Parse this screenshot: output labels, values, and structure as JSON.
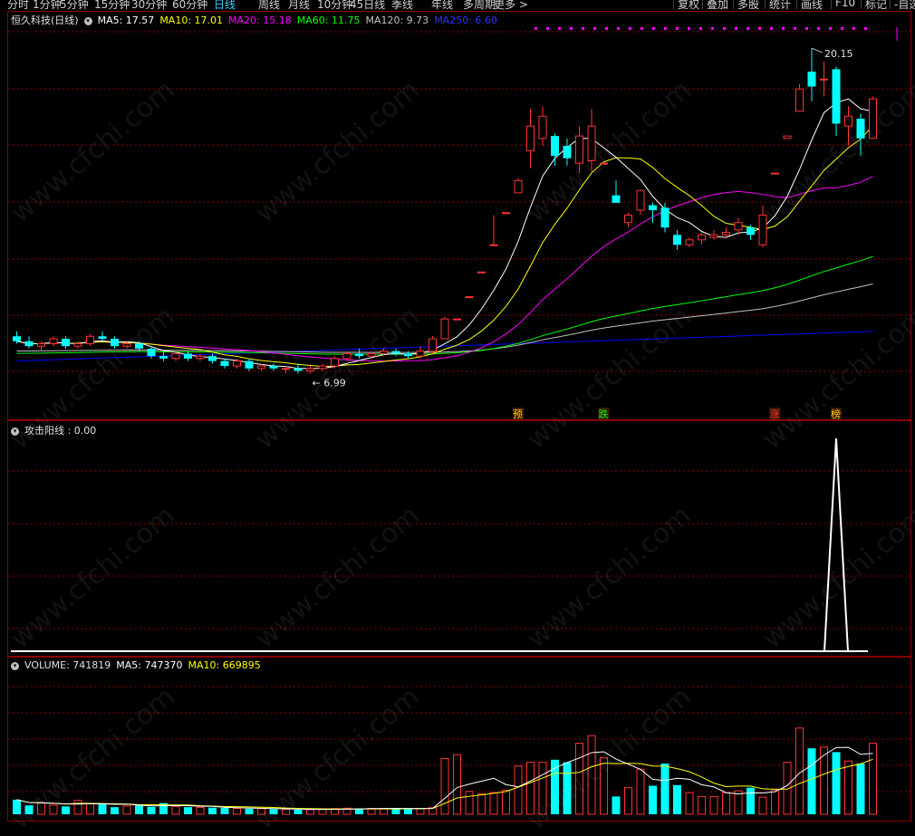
{
  "toolbar": {
    "periods": [
      "分时",
      "1分钟",
      "5分钟",
      "15分钟",
      "30分钟",
      "60分钟",
      "日线",
      "周线",
      "月线",
      "10分钟",
      "45日线",
      "季线",
      "年线",
      "多周期",
      "更多 >"
    ],
    "active": "日线",
    "right_buttons": [
      "复权",
      "叠加",
      "多股",
      "统计",
      "画线",
      "F10",
      "标记",
      "-自选"
    ]
  },
  "header": {
    "stock": "恒久科技(日线)",
    "ma5": "MA5: 17.57",
    "ma10": "MA10: 17.01",
    "ma20": "MA20: 15.18",
    "ma60": "MA60: 11.75",
    "ma120": "MA120: 9.73",
    "ma250": "MA250: 6.60"
  },
  "indicator_header": {
    "label": "攻击阳线 : 0.00"
  },
  "volume_header": {
    "volume": "VOLUME: 741819",
    "ma5": "MA5: 747370",
    "ma10": "MA10: 669895"
  },
  "colors": {
    "up": "#ff3232",
    "down": "#00ffff",
    "ma5": "#ffffff",
    "ma10": "#ffff00",
    "ma20": "#ff00ff",
    "ma60": "#00ff00",
    "ma120": "#c0c0c0",
    "ma250": "#0000ff",
    "grid": "#8b0000"
  },
  "watermark": "www.cfchi.com",
  "chart_data": [
    {
      "type": "candlestick",
      "title": "恒久科技(日线)",
      "ylim": [
        5.8,
        21.0
      ],
      "high_label": "20.15",
      "low_label": "6.99",
      "tags": [
        {
          "index": 41,
          "text": "预"
        },
        {
          "index": 48,
          "text": "跌"
        },
        {
          "index": 62,
          "text": "涨"
        },
        {
          "index": 67,
          "text": "榜"
        }
      ],
      "candles": [
        {
          "o": 8.5,
          "h": 8.7,
          "l": 8.2,
          "c": 8.3
        },
        {
          "o": 8.3,
          "h": 8.5,
          "l": 8.0,
          "c": 8.1
        },
        {
          "o": 8.1,
          "h": 8.3,
          "l": 7.9,
          "c": 8.2
        },
        {
          "o": 8.2,
          "h": 8.5,
          "l": 8.1,
          "c": 8.4
        },
        {
          "o": 8.4,
          "h": 8.5,
          "l": 8.0,
          "c": 8.1
        },
        {
          "o": 8.1,
          "h": 8.3,
          "l": 8.0,
          "c": 8.2
        },
        {
          "o": 8.2,
          "h": 8.6,
          "l": 8.1,
          "c": 8.5
        },
        {
          "o": 8.5,
          "h": 8.7,
          "l": 8.3,
          "c": 8.4
        },
        {
          "o": 8.4,
          "h": 8.5,
          "l": 8.0,
          "c": 8.1
        },
        {
          "o": 8.1,
          "h": 8.3,
          "l": 8.0,
          "c": 8.2
        },
        {
          "o": 8.2,
          "h": 8.3,
          "l": 7.9,
          "c": 8.0
        },
        {
          "o": 8.0,
          "h": 8.1,
          "l": 7.6,
          "c": 7.7
        },
        {
          "o": 7.7,
          "h": 7.9,
          "l": 7.5,
          "c": 7.6
        },
        {
          "o": 7.6,
          "h": 7.9,
          "l": 7.5,
          "c": 7.8
        },
        {
          "o": 7.8,
          "h": 7.9,
          "l": 7.5,
          "c": 7.6
        },
        {
          "o": 7.6,
          "h": 7.8,
          "l": 7.5,
          "c": 7.7
        },
        {
          "o": 7.7,
          "h": 7.8,
          "l": 7.4,
          "c": 7.5
        },
        {
          "o": 7.5,
          "h": 7.6,
          "l": 7.2,
          "c": 7.3
        },
        {
          "o": 7.3,
          "h": 7.6,
          "l": 7.2,
          "c": 7.5
        },
        {
          "o": 7.5,
          "h": 7.6,
          "l": 7.1,
          "c": 7.2
        },
        {
          "o": 7.2,
          "h": 7.4,
          "l": 7.1,
          "c": 7.3
        },
        {
          "o": 7.3,
          "h": 7.4,
          "l": 7.1,
          "c": 7.2
        },
        {
          "o": 7.2,
          "h": 7.3,
          "l": 7.0,
          "c": 7.2
        },
        {
          "o": 7.2,
          "h": 7.4,
          "l": 7.0,
          "c": 7.1
        },
        {
          "o": 7.1,
          "h": 7.3,
          "l": 6.99,
          "c": 7.2
        },
        {
          "o": 7.2,
          "h": 7.4,
          "l": 7.1,
          "c": 7.3
        },
        {
          "o": 7.3,
          "h": 7.7,
          "l": 7.2,
          "c": 7.6
        },
        {
          "o": 7.6,
          "h": 7.9,
          "l": 7.5,
          "c": 7.8
        },
        {
          "o": 7.8,
          "h": 8.0,
          "l": 7.6,
          "c": 7.7
        },
        {
          "o": 7.7,
          "h": 7.9,
          "l": 7.6,
          "c": 7.8
        },
        {
          "o": 7.8,
          "h": 8.0,
          "l": 7.7,
          "c": 7.9
        },
        {
          "o": 7.9,
          "h": 8.0,
          "l": 7.7,
          "c": 7.8
        },
        {
          "o": 7.8,
          "h": 7.9,
          "l": 7.6,
          "c": 7.7
        },
        {
          "o": 7.7,
          "h": 8.1,
          "l": 7.6,
          "c": 7.9
        },
        {
          "o": 7.9,
          "h": 8.5,
          "l": 7.8,
          "c": 8.4
        },
        {
          "o": 8.4,
          "h": 9.3,
          "l": 8.4,
          "c": 9.2
        },
        {
          "o": 9.2,
          "h": 9.2,
          "l": 9.2,
          "c": 9.2
        },
        {
          "o": 10.1,
          "h": 10.1,
          "l": 10.1,
          "c": 10.1
        },
        {
          "o": 11.1,
          "h": 11.1,
          "l": 11.1,
          "c": 11.1
        },
        {
          "o": 12.2,
          "h": 13.4,
          "l": 12.2,
          "c": 12.2
        },
        {
          "o": 13.5,
          "h": 13.5,
          "l": 13.5,
          "c": 13.5
        },
        {
          "o": 14.3,
          "h": 14.9,
          "l": 14.3,
          "c": 14.8
        },
        {
          "o": 16.0,
          "h": 17.7,
          "l": 15.3,
          "c": 17.0
        },
        {
          "o": 16.5,
          "h": 17.8,
          "l": 16.2,
          "c": 17.4
        },
        {
          "o": 16.6,
          "h": 16.7,
          "l": 15.4,
          "c": 15.8
        },
        {
          "o": 16.2,
          "h": 16.5,
          "l": 15.4,
          "c": 15.7
        },
        {
          "o": 15.5,
          "h": 17.0,
          "l": 15.1,
          "c": 16.6
        },
        {
          "o": 15.6,
          "h": 17.7,
          "l": 15.2,
          "c": 17.0
        },
        {
          "o": 15.5,
          "h": 15.5,
          "l": 15.5,
          "c": 15.5
        },
        {
          "o": 14.2,
          "h": 14.8,
          "l": 13.9,
          "c": 13.9
        },
        {
          "o": 13.1,
          "h": 13.5,
          "l": 12.9,
          "c": 13.4
        },
        {
          "o": 13.6,
          "h": 14.4,
          "l": 13.4,
          "c": 14.4
        },
        {
          "o": 13.8,
          "h": 13.9,
          "l": 13.1,
          "c": 13.6
        },
        {
          "o": 13.7,
          "h": 13.9,
          "l": 12.7,
          "c": 12.9
        },
        {
          "o": 12.6,
          "h": 12.8,
          "l": 12.0,
          "c": 12.2
        },
        {
          "o": 12.2,
          "h": 12.5,
          "l": 12.1,
          "c": 12.4
        },
        {
          "o": 12.4,
          "h": 12.7,
          "l": 12.2,
          "c": 12.6
        },
        {
          "o": 12.5,
          "h": 12.8,
          "l": 12.4,
          "c": 12.6
        },
        {
          "o": 12.6,
          "h": 12.9,
          "l": 12.5,
          "c": 12.7
        },
        {
          "o": 12.8,
          "h": 13.3,
          "l": 12.6,
          "c": 13.1
        },
        {
          "o": 12.9,
          "h": 13.0,
          "l": 12.4,
          "c": 12.6
        },
        {
          "o": 12.2,
          "h": 13.8,
          "l": 12.1,
          "c": 13.4
        },
        {
          "o": 15.1,
          "h": 15.1,
          "l": 15.1,
          "c": 15.1
        },
        {
          "o": 16.5,
          "h": 16.5,
          "l": 16.5,
          "c": 16.6
        },
        {
          "o": 17.6,
          "h": 18.7,
          "l": 17.6,
          "c": 18.5
        },
        {
          "o": 19.2,
          "h": 20.15,
          "l": 18.0,
          "c": 18.6
        },
        {
          "o": 18.9,
          "h": 19.6,
          "l": 18.2,
          "c": 18.9
        },
        {
          "o": 19.3,
          "h": 19.4,
          "l": 16.6,
          "c": 17.1
        },
        {
          "o": 17.0,
          "h": 17.8,
          "l": 16.2,
          "c": 17.4
        },
        {
          "o": 17.3,
          "h": 17.5,
          "l": 15.8,
          "c": 16.5
        },
        {
          "o": 16.5,
          "h": 18.2,
          "l": 16.5,
          "c": 18.1
        }
      ]
    },
    {
      "type": "line",
      "title": "攻击阳线",
      "value": 0.0,
      "spike": {
        "index": 67,
        "value": 1
      }
    },
    {
      "type": "bar",
      "title": "VOLUME",
      "ylim": [
        0,
        1100000
      ],
      "volumes": [
        115000,
        70000,
        88000,
        72000,
        62000,
        110000,
        85000,
        80000,
        56000,
        65000,
        70000,
        58000,
        88000,
        62000,
        56000,
        54000,
        52000,
        50000,
        46000,
        44000,
        44000,
        40000,
        40000,
        36000,
        36000,
        38000,
        44000,
        48000,
        46000,
        46000,
        45000,
        45000,
        45000,
        46000,
        52000,
        440000,
        470000,
        180000,
        160000,
        170000,
        190000,
        380000,
        410000,
        410000,
        430000,
        410000,
        560000,
        620000,
        445000,
        140000,
        210000,
        355000,
        225000,
        400000,
        230000,
        170000,
        140000,
        140000,
        170000,
        185000,
        210000,
        135000,
        190000,
        410000,
        680000,
        520000,
        530000,
        490000,
        420000,
        400000,
        560000
      ]
    }
  ]
}
